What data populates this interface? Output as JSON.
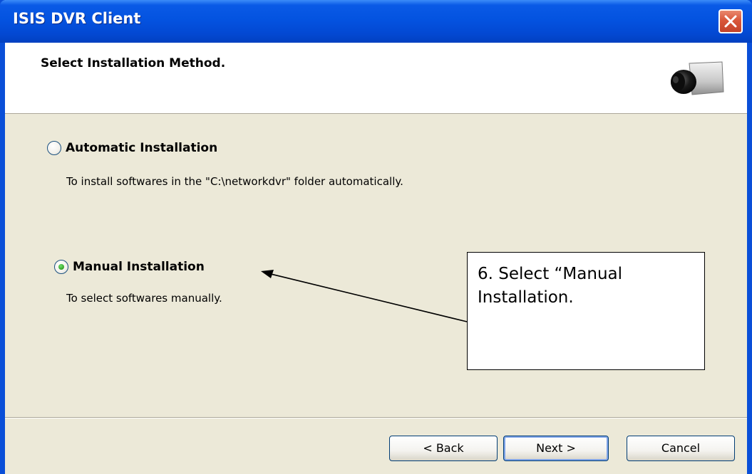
{
  "window": {
    "title": "ISIS DVR Client"
  },
  "header": {
    "title": "Select Installation Method.",
    "icon": "camera-icon"
  },
  "options": [
    {
      "label": "Automatic Installation",
      "description": "To install softwares in the \"C:\\networkdvr\" folder automatically.",
      "selected": false
    },
    {
      "label": "Manual Installation",
      "description": "To select softwares manually.",
      "selected": true
    }
  ],
  "annotation": {
    "text": "6. Select “Manual Installation."
  },
  "buttons": {
    "back": "< Back",
    "next": "Next >",
    "cancel": "Cancel"
  },
  "colors": {
    "titlebar": "#0453e0",
    "close": "#d9573a",
    "background": "#ece9d8"
  }
}
